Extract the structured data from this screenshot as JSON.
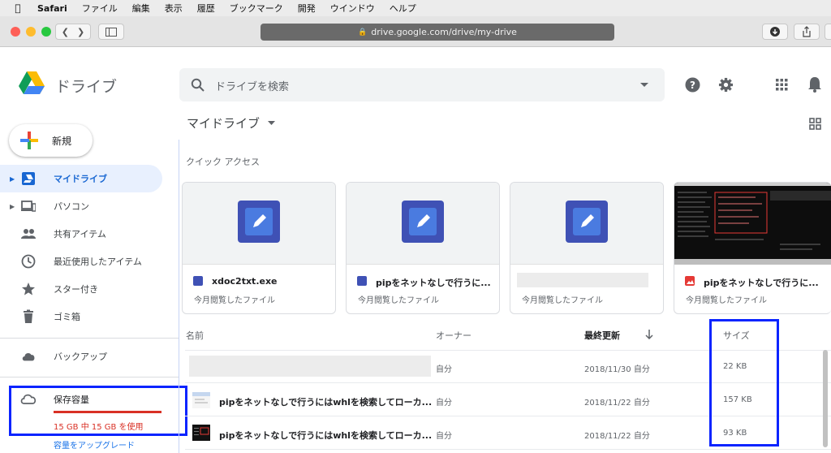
{
  "menubar": {
    "app": "Safari",
    "items": [
      "ファイル",
      "編集",
      "表示",
      "履歴",
      "ブックマーク",
      "開発",
      "ウインドウ",
      "ヘルプ"
    ]
  },
  "browser": {
    "url": "drive.google.com/drive/my-drive"
  },
  "header": {
    "logo_text": "ドライブ",
    "search_placeholder": "ドライブを検索"
  },
  "sidebar": {
    "new_label": "新規",
    "items": [
      {
        "label": "マイドライブ",
        "icon": "drive-icon"
      },
      {
        "label": "パソコン",
        "icon": "computer-icon"
      },
      {
        "label": "共有アイテム",
        "icon": "people-icon"
      },
      {
        "label": "最近使用したアイテム",
        "icon": "clock-icon"
      },
      {
        "label": "スター付き",
        "icon": "star-icon"
      },
      {
        "label": "ゴミ箱",
        "icon": "trash-icon"
      }
    ],
    "backup_label": "バックアップ",
    "storage_title": "保存容量",
    "storage_usage": "15 GB 中 15 GB を使用",
    "upgrade_label": "容量をアップグレード"
  },
  "main": {
    "breadcrumb": "マイドライブ",
    "quick_access_title": "クイック アクセス",
    "cards": [
      {
        "name": "xdoc2txt.exe",
        "sub": "今月閲覧したファイル"
      },
      {
        "name": "pipをネットなしで行うに...",
        "sub": "今月閲覧したファイル"
      },
      {
        "name": "",
        "sub": "今月閲覧したファイル"
      },
      {
        "name": "pipをネットなしで行うに...",
        "sub": "今月閲覧したファイル"
      }
    ],
    "columns": {
      "name": "名前",
      "owner": "オーナー",
      "modified": "最終更新",
      "size": "サイズ"
    },
    "rows": [
      {
        "name": "",
        "owner": "自分",
        "modified": "2018/11/30 自分",
        "size": "22 KB"
      },
      {
        "name": "pipをネットなしで行うにはwhlを検索してローカ...",
        "owner": "自分",
        "modified": "2018/11/22 自分",
        "size": "157 KB"
      },
      {
        "name": "pipをネットなしで行うにはwhlを検索してローカ...",
        "owner": "自分",
        "modified": "2018/11/22 自分",
        "size": "93 KB"
      }
    ]
  },
  "colors": {
    "accent_blue": "#1967d2",
    "annotation_blue": "#0b24ff",
    "storage_red": "#d93025"
  }
}
